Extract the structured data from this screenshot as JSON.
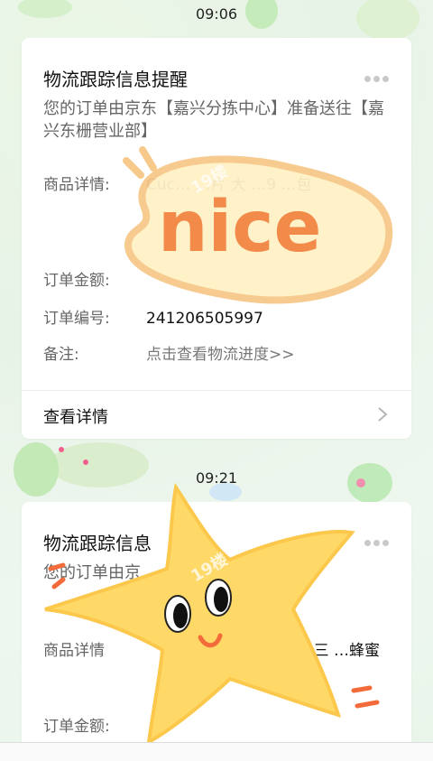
{
  "messages": [
    {
      "time": "09:06",
      "title": "物流跟踪信息提醒",
      "subtitle": "您的订单由京东【嘉兴分拣中心】准备送往【嘉兴东栅营业部】",
      "fields": {
        "goods_label": "商品详情:",
        "goods_value": "Cuc… …片 大 …9 …包",
        "amount_label": "订单金额:",
        "amount_value": "",
        "order_label": "订单编号:",
        "order_value": "241206505997",
        "note_label": "备注:",
        "note_value": "点击查看物流进度>>"
      },
      "detail_label": "查看详情"
    },
    {
      "time": "09:21",
      "title": "物流跟踪信息",
      "subtitle": "您的订单由京 … 送往 【嘉…",
      "fields": {
        "goods_label": "商品详情",
        "goods_value": "装280g 三 …蜂蜜",
        "amount_label": "订单金额:"
      }
    }
  ],
  "stickers": {
    "nice_text": "nice",
    "watermark_text": "19楼"
  },
  "colors": {
    "nice_text": "#f28a4a",
    "nice_blob": "#fff1c6",
    "star": "#ffd968",
    "accent_orange": "#f36b3b"
  }
}
